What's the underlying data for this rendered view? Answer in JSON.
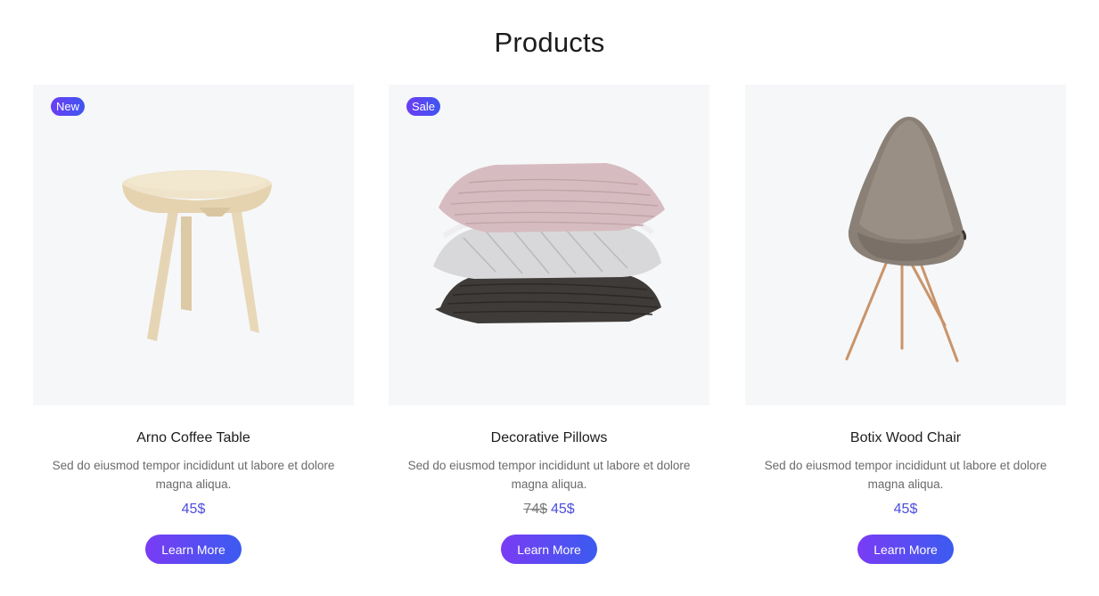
{
  "section": {
    "title": "Products"
  },
  "products": [
    {
      "badge": "New",
      "image_icon": "round-side-table-image",
      "name": "Arno Coffee Table",
      "description": "Sed do eiusmod tempor incididunt ut labore et dolore magna aliqua.",
      "old_price": "",
      "price": "45$",
      "button_label": "Learn More"
    },
    {
      "badge": "Sale",
      "image_icon": "stacked-pillows-image",
      "name": "Decorative Pillows",
      "description": "Sed do eiusmod tempor incididunt ut labore et dolore magna aliqua.",
      "old_price": "74$",
      "price": "45$",
      "button_label": "Learn More"
    },
    {
      "badge": "",
      "image_icon": "drop-chair-image",
      "name": "Botix Wood Chair",
      "description": "Sed do eiusmod tempor incididunt ut labore et dolore magna aliqua.",
      "old_price": "",
      "price": "45$",
      "button_label": "Learn More"
    }
  ],
  "colors": {
    "accent": "#4c4de0",
    "button_gradient_start": "#7a3cf4",
    "button_gradient_end": "#3b5bf0",
    "card_background": "#f6f7f9"
  }
}
